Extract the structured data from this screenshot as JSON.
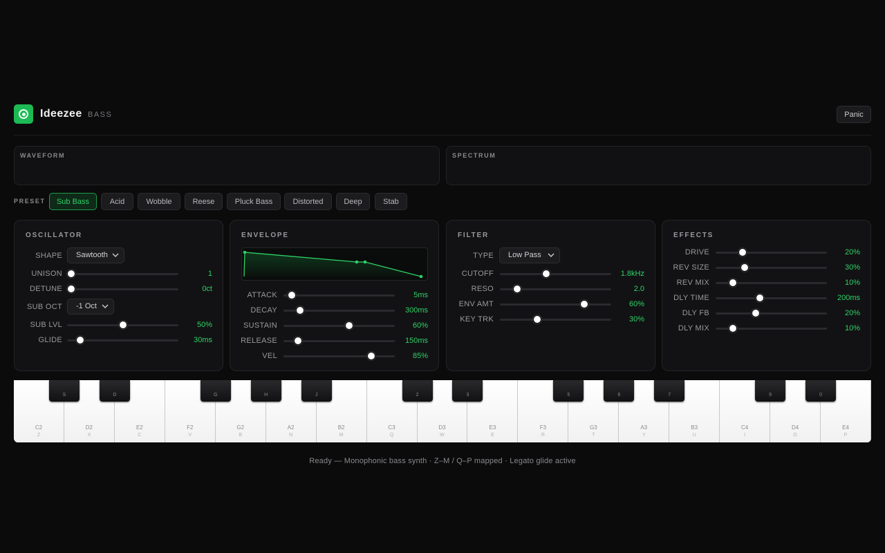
{
  "app": {
    "title": "Ideezee",
    "subtitle": "BASS",
    "panic_label": "Panic",
    "logo_icon": "disc-icon",
    "accent": "#1db954"
  },
  "viz": {
    "waveform_label": "WAVEFORM",
    "spectrum_label": "SPECTRUM"
  },
  "presets": {
    "label": "PRESET",
    "items": [
      "Sub Bass",
      "Acid",
      "Wobble",
      "Reese",
      "Pluck Bass",
      "Distorted",
      "Deep",
      "Stab"
    ],
    "active": "Sub Bass"
  },
  "oscillator": {
    "title": "OSCILLATOR",
    "shape_label": "SHAPE",
    "shape_value": "Sawtooth",
    "unison_label": "UNISON",
    "unison_value": "1",
    "unison_level": 0.0,
    "detune_label": "DETUNE",
    "detune_value": "0ct",
    "detune_level": 0.0,
    "suboct_label": "SUB OCT",
    "suboct_value": "-1 Oct",
    "sublvl_label": "SUB LVL",
    "sublvl_value": "50%",
    "sublvl_level": 0.5,
    "glide_label": "GLIDE",
    "glide_value": "30ms",
    "glide_level": 0.09
  },
  "envelope": {
    "title": "ENVELOPE",
    "attack_label": "ATTACK",
    "attack_value": "5ms",
    "attack_level": 0.04,
    "decay_label": "DECAY",
    "decay_value": "300ms",
    "decay_level": 0.12,
    "sustain_label": "SUSTAIN",
    "sustain_value": "60%",
    "sustain_level": 0.6,
    "release_label": "RELEASE",
    "release_value": "150ms",
    "release_level": 0.1,
    "vel_label": "VEL",
    "vel_value": "85%",
    "vel_level": 0.81
  },
  "filter": {
    "title": "FILTER",
    "type_label": "TYPE",
    "type_value": "Low Pass",
    "cutoff_label": "CUTOFF",
    "cutoff_value": "1.8kHz",
    "cutoff_level": 0.41,
    "reso_label": "RESO",
    "reso_value": "2.0",
    "reso_level": 0.13,
    "envamt_label": "ENV AMT",
    "envamt_value": "60%",
    "envamt_level": 0.78,
    "keytrk_label": "KEY TRK",
    "keytrk_value": "30%",
    "keytrk_level": 0.32
  },
  "effects": {
    "title": "EFFECTS",
    "drive_label": "DRIVE",
    "drive_value": "20%",
    "drive_level": 0.22,
    "revsize_label": "REV SIZE",
    "revsize_value": "30%",
    "revsize_level": 0.24,
    "revmix_label": "REV MIX",
    "revmix_value": "10%",
    "revmix_level": 0.13,
    "dlytime_label": "DLY TIME",
    "dlytime_value": "200ms",
    "dlytime_level": 0.39,
    "dlyfb_label": "DLY FB",
    "dlyfb_value": "20%",
    "dlyfb_level": 0.35,
    "dlymix_label": "DLY MIX",
    "dlymix_value": "10%",
    "dlymix_level": 0.13
  },
  "keyboard": {
    "white_keys": [
      {
        "note": "C2",
        "key": "Z"
      },
      {
        "note": "D2",
        "key": "X"
      },
      {
        "note": "E2",
        "key": "C"
      },
      {
        "note": "F2",
        "key": "V"
      },
      {
        "note": "G2",
        "key": "B"
      },
      {
        "note": "A2",
        "key": "N"
      },
      {
        "note": "B2",
        "key": "M"
      },
      {
        "note": "C3",
        "key": "Q"
      },
      {
        "note": "D3",
        "key": "W"
      },
      {
        "note": "E3",
        "key": "E"
      },
      {
        "note": "F3",
        "key": "R"
      },
      {
        "note": "G3",
        "key": "T"
      },
      {
        "note": "A3",
        "key": "Y"
      },
      {
        "note": "B3",
        "key": "U"
      },
      {
        "note": "C4",
        "key": "I"
      },
      {
        "note": "D4",
        "key": "O"
      },
      {
        "note": "E4",
        "key": "P"
      }
    ],
    "black_keys": [
      "S",
      "D",
      "G",
      "H",
      "J",
      "2",
      "3",
      "5",
      "6",
      "7",
      "9",
      "0"
    ]
  },
  "status": "Ready — Monophonic bass synth · Z–M / Q–P mapped · Legato glide active"
}
